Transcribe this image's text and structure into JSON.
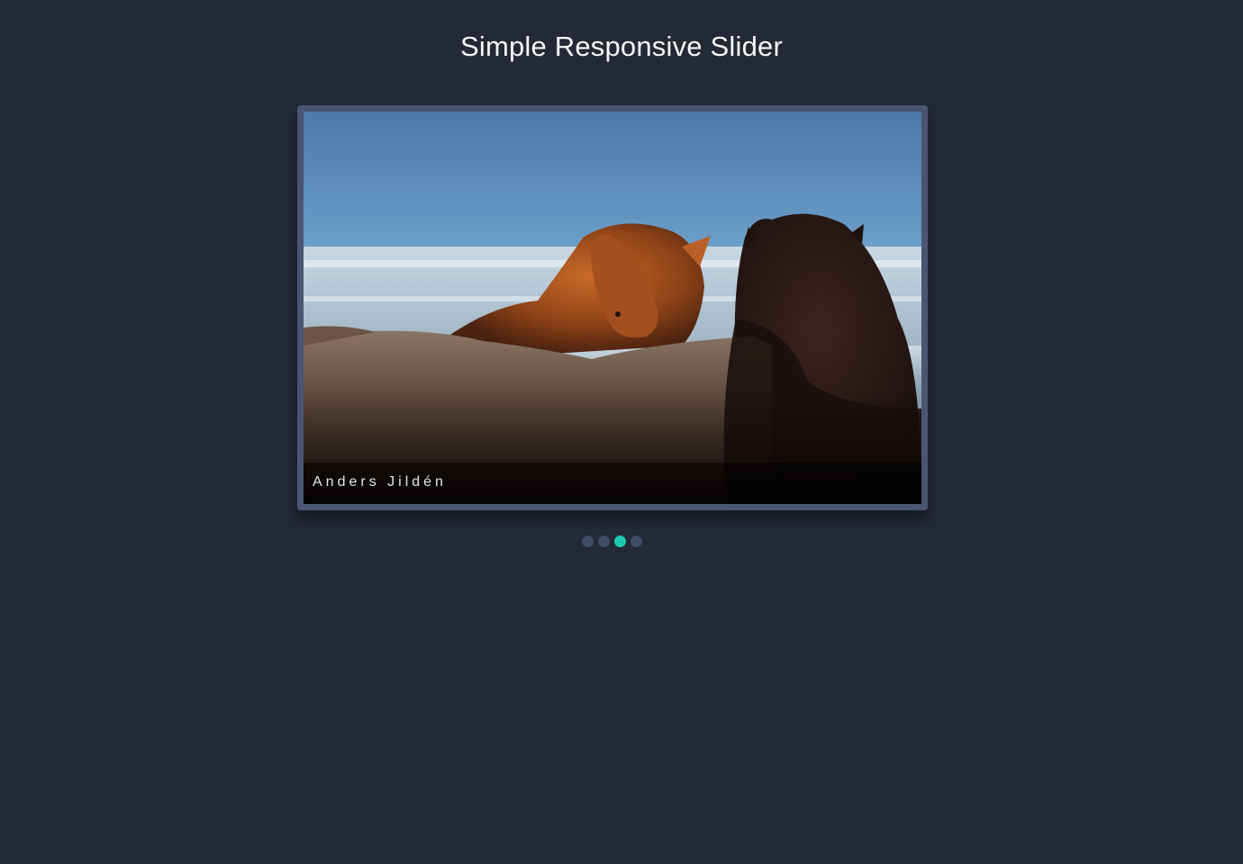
{
  "page": {
    "title": "Simple Responsive Slider"
  },
  "slider": {
    "caption": "Anders Jildén",
    "slide_count": 4,
    "active_index": 2,
    "dots": [
      {
        "label": "slide-1",
        "active": false
      },
      {
        "label": "slide-2",
        "active": false
      },
      {
        "label": "slide-3",
        "active": true
      },
      {
        "label": "slide-4",
        "active": false
      }
    ]
  },
  "colors": {
    "background": "#232937",
    "frame": "#4a5570",
    "dot_inactive": "#3f4b63",
    "dot_active": "#1ec8b0"
  }
}
